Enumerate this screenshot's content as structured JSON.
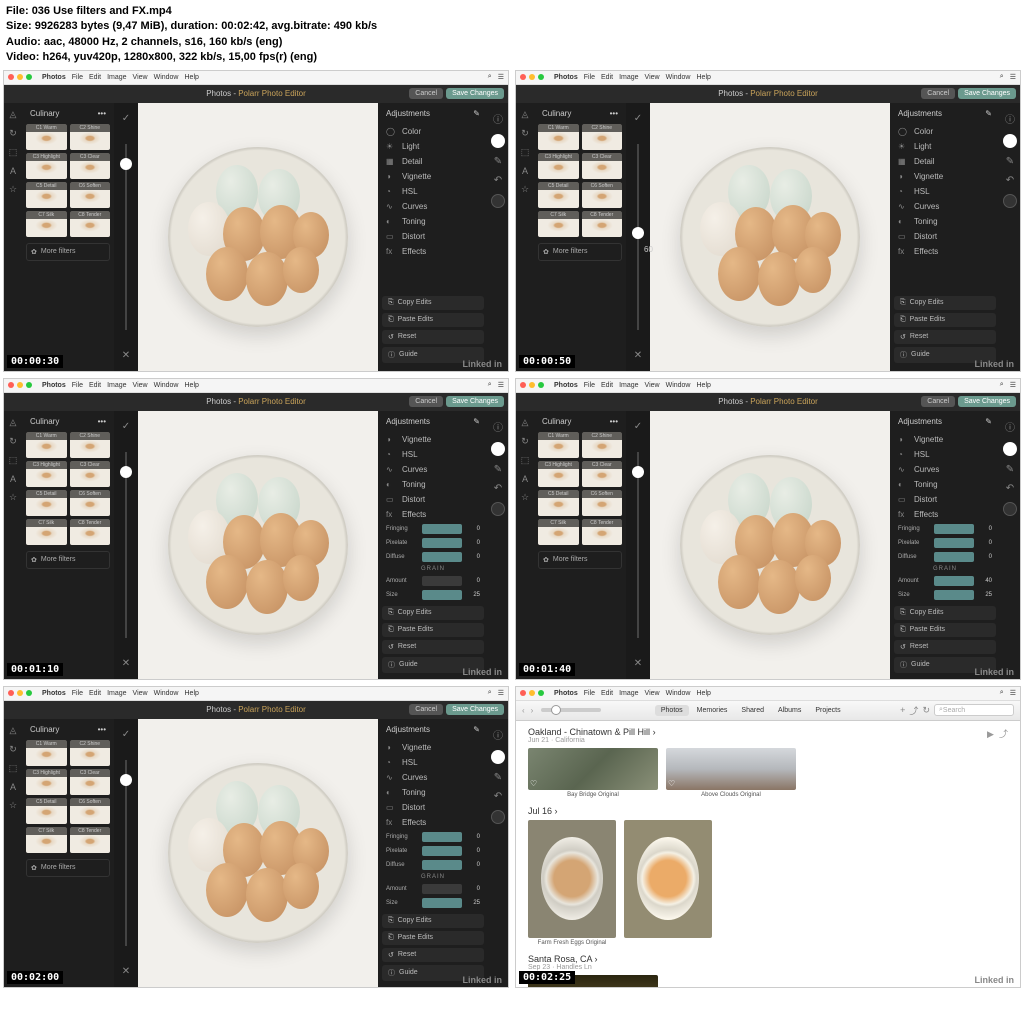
{
  "meta": {
    "file_label": "File:",
    "file": "036 Use filters and FX.mp4",
    "size_label": "Size:",
    "size": "9926283 bytes (9,47 MiB), duration: 00:02:42, avg.bitrate: 490 kb/s",
    "audio_label": "Audio:",
    "audio": "aac, 48000 Hz, 2 channels, s16, 160 kb/s (eng)",
    "video_label": "Video:",
    "video": "h264, yuv420p, 1280x800, 322 kb/s, 15,00 fps(r) (eng)"
  },
  "menubar": {
    "app": "Photos",
    "items": [
      "File",
      "Edit",
      "Image",
      "View",
      "Window",
      "Help"
    ]
  },
  "titlebar": {
    "prefix": "Photos - ",
    "title": "Polarr Photo Editor",
    "cancel": "Cancel",
    "save": "Save Changes"
  },
  "sidebar": {
    "category": "Culinary",
    "filters": [
      "C1 Warm",
      "C2 Shine",
      "C3 Highlight",
      "C3 Clear",
      "C5 Detail",
      "C6 Soften",
      "C7 Silk",
      "C8 Tender"
    ],
    "more": "More filters"
  },
  "adjustments": {
    "header": "Adjustments",
    "items": [
      {
        "icon": "◯",
        "label": "Color"
      },
      {
        "icon": "☀",
        "label": "Light"
      },
      {
        "icon": "▦",
        "label": "Detail"
      },
      {
        "icon": "◑",
        "label": "Vignette"
      },
      {
        "icon": "◔",
        "label": "HSL"
      },
      {
        "icon": "∿",
        "label": "Curves"
      },
      {
        "icon": "◐",
        "label": "Toning"
      },
      {
        "icon": "▭",
        "label": "Distort"
      },
      {
        "icon": "fx",
        "label": "Effects"
      }
    ],
    "fx_sliders": [
      {
        "label": "Fringing",
        "val": "0"
      },
      {
        "label": "Pixelate",
        "val": "0"
      },
      {
        "label": "Diffuse",
        "val": "0"
      }
    ],
    "grain_header": "GRAIN",
    "grain_sliders": [
      {
        "label": "Amount",
        "val": "0"
      },
      {
        "label": "Size",
        "val": "25"
      }
    ],
    "copy": "Copy Edits",
    "paste": "Paste Edits",
    "reset": "Reset",
    "guide": "Guide"
  },
  "slider_val": "60",
  "timestamps": [
    "00:00:30",
    "00:00:50",
    "00:01:10",
    "00:01:40",
    "00:02:00",
    "00:02:25"
  ],
  "watermark": "Linked in",
  "photos": {
    "tabs": [
      "Photos",
      "Memories",
      "Shared",
      "Albums",
      "Projects"
    ],
    "search": "Search",
    "section1": {
      "title": "Oakland - Chinatown & Pill Hill",
      "sub": "Jun 21 · California"
    },
    "captions": [
      "Bay Bridge Original",
      "Above Clouds Original"
    ],
    "date2": "Jul 16",
    "egg_caption": "Farm Fresh Eggs Original",
    "section3": {
      "title": "Santa Rosa, CA",
      "sub": "Sep 23 · Handles Ln"
    }
  },
  "grain_alt": [
    {
      "label": "Amount",
      "val": "40"
    },
    {
      "label": "Size",
      "val": "25"
    }
  ]
}
